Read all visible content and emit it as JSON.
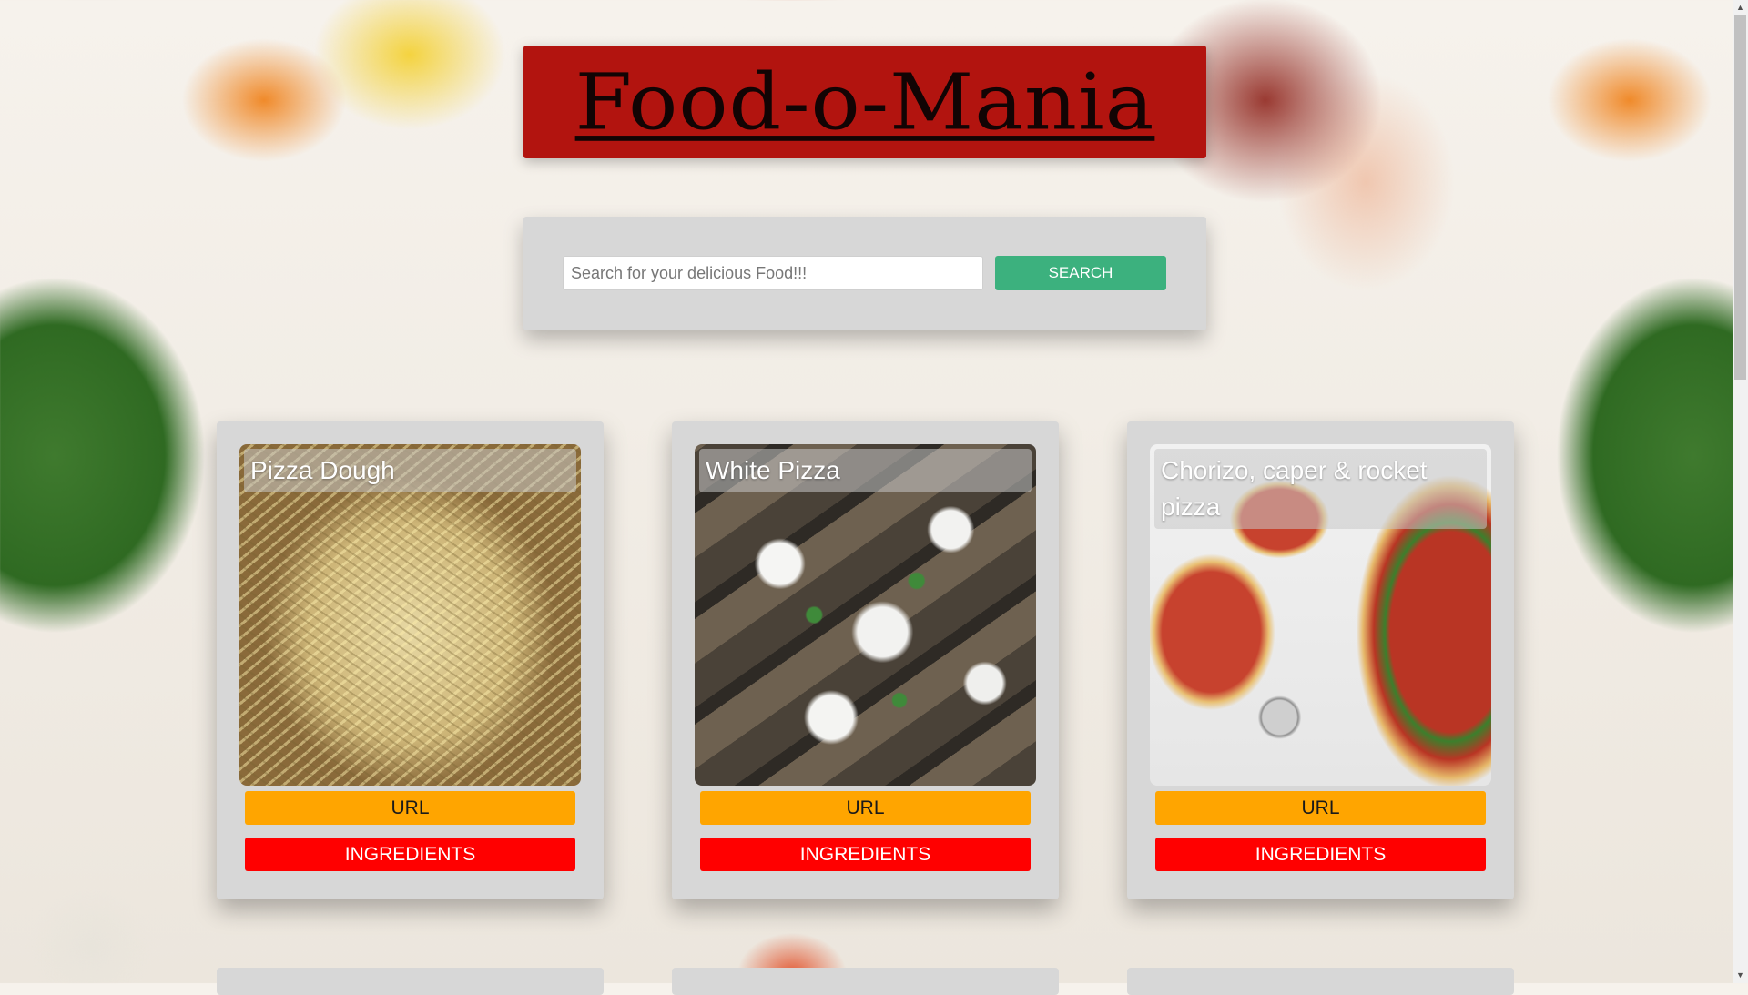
{
  "app": {
    "logo_text": "Food-o-Mania"
  },
  "search": {
    "placeholder": "Search for your delicious Food!!!",
    "value": "",
    "button_label": "SEARCH"
  },
  "recipes": [
    {
      "title": "Pizza Dough",
      "url_label": "URL",
      "ingredients_label": "INGREDIENTS"
    },
    {
      "title": "White Pizza",
      "url_label": "URL",
      "ingredients_label": "INGREDIENTS"
    },
    {
      "title": "Chorizo, caper & rocket pizza",
      "url_label": "URL",
      "ingredients_label": "INGREDIENTS"
    }
  ],
  "colors": {
    "header_bg": "#b2140f",
    "search_button": "#3cb17e",
    "url_button": "#ffa500",
    "ingredients_button": "#ff0000",
    "panel_bg": "#d7d7d7"
  }
}
